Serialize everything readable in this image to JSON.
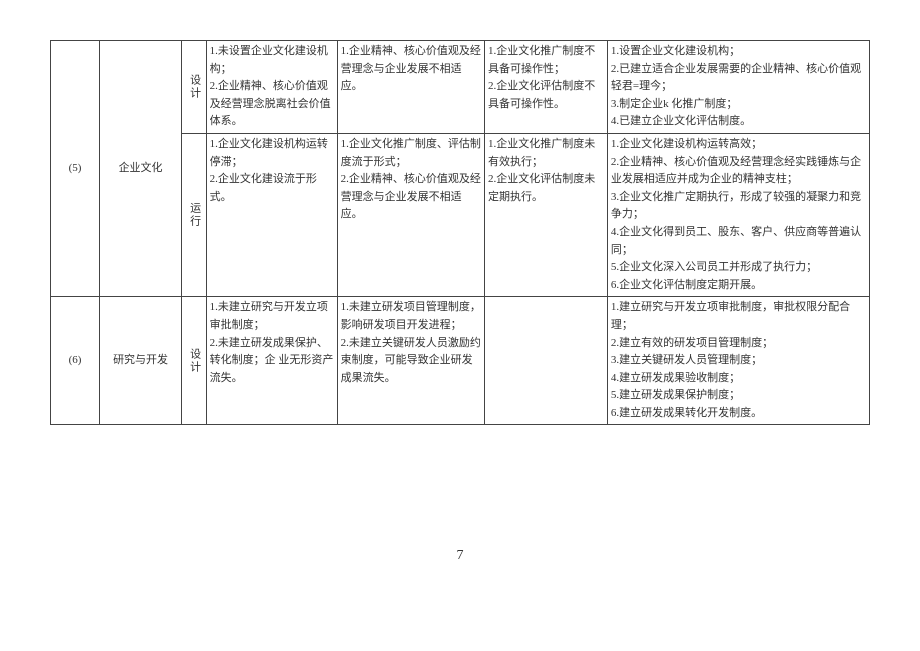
{
  "page_number": "7",
  "table": {
    "row1": {
      "idx": "(5)",
      "cat": "企业文化",
      "phase1": "设计",
      "c1a": "1.未设置企业文化建设机构；\n2.企业精神、核心价值观及经营理念脱离社会价值体系。",
      "c1b": "1.企业精神、核心价值观及经营理念与企业发展不相适应。",
      "c1c": "1.企业文化推广制度不具备可操作性；\n2.企业文化评估制度不具备可操作性。",
      "c1d": "1.设置企业文化建设机构；\n2.已建立适合企业发展需要的企业精神、核心价值观\n   轻君=理今；\n3.制定企业k 化推广制度；\n4.已建立企业文化评估制度。",
      "phase2": "运行",
      "c2a": "1.企业文化建设机构运转停滞；\n2.企业文化建设流于形式。",
      "c2b": "1.企业文化推广制度、评估制度流于形式；\n2.企业精神、核心价值观及经营理念与企业发展不相适应。",
      "c2c": "1.企业文化推广制度未有效执行；\n2.企业文化评估制度未定期执行。",
      "c2d": "1.企业文化建设机构运转高效；\n2.企业精神、核心价值观及经营理念经实践锤炼与企 业发展相适应并成为企业的精神支柱；\n3.企业文化推广定期执行，形成了较强的凝聚力和竞  争力；\n4.企业文化得到员工、股东、客户、供应商等普遍认  同；\n5.企业文化深入公司员工并形成了执行力；\n6.企业文化评估制度定期开展。"
    },
    "row2": {
      "idx": "(6)",
      "cat": "研究与开发",
      "phase1": "设计",
      "c1a": "1.未建立研究与开发立项审批制度；\n2.未建立研发成果保护、转化制度；企 业无形资产流失。",
      "c1b": "1.未建立研发项目管理制度，影响研发项目开发进程；\n2.未建立关键研发人员激励约束制度，可能导致企业研发成果流失。",
      "c1c": "",
      "c1d": "1.建立研究与开发立项审批制度，审批权限分配合理；\n2.建立有效的研发项目管理制度；\n3.建立关键研发人员管理制度；\n4.建立研发成果验收制度；\n5.建立研发成果保护制度；\n6.建立研发成果转化开发制度。"
    }
  }
}
